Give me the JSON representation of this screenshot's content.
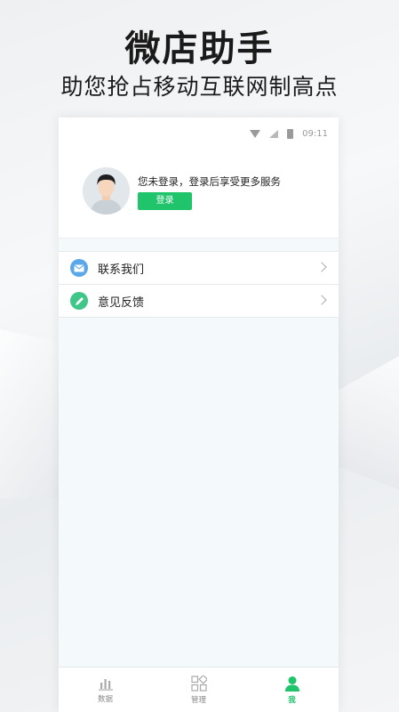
{
  "hero": {
    "title": "微店助手",
    "subtitle": "助您抢占移动互联网制高点"
  },
  "status_bar": {
    "time": "09:11",
    "icons": [
      "wifi-icon",
      "signal-icon",
      "battery-icon"
    ]
  },
  "profile": {
    "notice": "您未登录，登录后享受更多服务",
    "login_label": "登录"
  },
  "menu": {
    "items": [
      {
        "label": "联系我们",
        "icon": "mail-icon",
        "color": "#5aa8ea"
      },
      {
        "label": "意见反馈",
        "icon": "pencil-icon",
        "color": "#3fc78a"
      }
    ]
  },
  "tabbar": {
    "tabs": [
      {
        "label": "数据",
        "icon": "chart-icon",
        "active": false
      },
      {
        "label": "管理",
        "icon": "grid-icon",
        "active": false
      },
      {
        "label": "我",
        "icon": "person-icon",
        "active": true
      }
    ]
  },
  "colors": {
    "accent": "#1fc46b",
    "background": "#f4f9fb"
  }
}
